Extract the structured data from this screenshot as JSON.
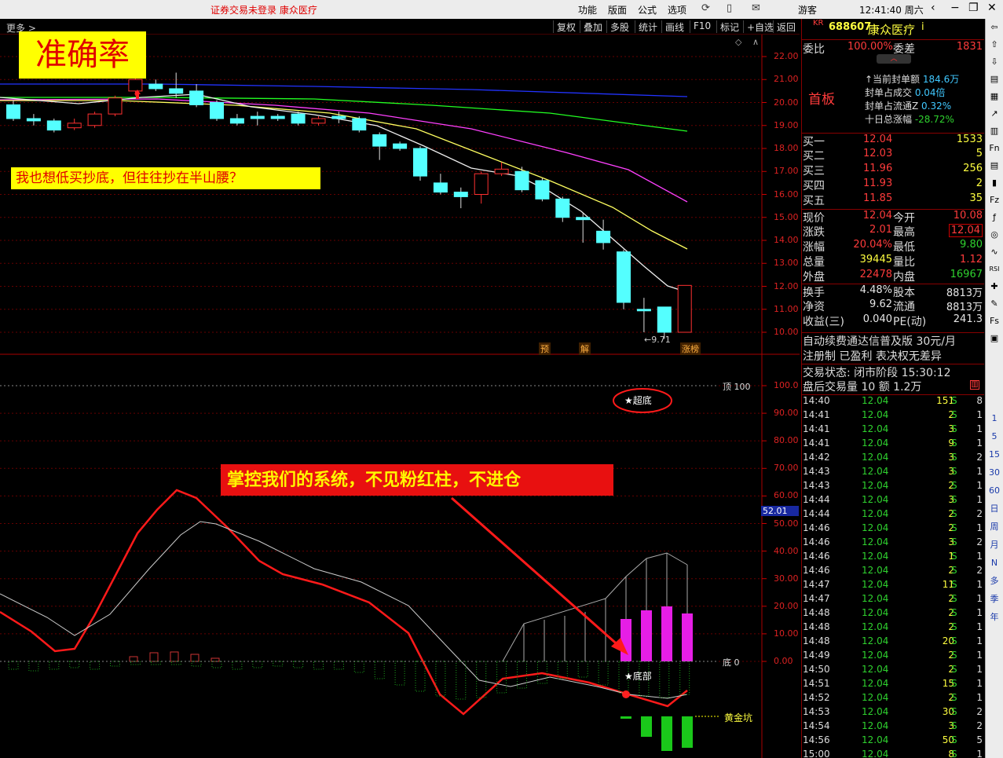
{
  "titlebar": {
    "status": "证券交易未登录  康众医疗",
    "menus": [
      "功能",
      "版面",
      "公式",
      "选项"
    ],
    "user": "游客",
    "clock": "12:41:40 周六"
  },
  "toolbar": {
    "more": "更多 >",
    "buttons": [
      "复权",
      "叠加",
      "多股",
      "统计",
      "画线",
      "F10",
      "标记",
      "+自选",
      "返回"
    ]
  },
  "annotations": {
    "accuracy": "准确率",
    "question": "我也想低买抄底，但往往抄在半山腰？",
    "system": "掌控我们的系统，不见粉红柱，不进仓",
    "chaodi": "★超底",
    "dibu": "★底部",
    "low_price": "←9.71",
    "tag_yu": "预",
    "tag_jie": "解",
    "tag_zhangbang": "涨榜",
    "top_label": "顶 100",
    "bottom_label": "底 0",
    "golden_pit": "黄金坑",
    "cursor_value": "52.01"
  },
  "price_axis": [
    "22.00",
    "21.00",
    "20.00",
    "19.00",
    "18.00",
    "17.00",
    "16.00",
    "15.00",
    "14.00",
    "13.00",
    "12.00",
    "11.00",
    "10.00"
  ],
  "ind_axis": [
    "100.0",
    "90.00",
    "80.00",
    "70.00",
    "60.00",
    "50.00",
    "40.00",
    "30.00",
    "20.00",
    "10.00",
    "0.00"
  ],
  "chart_data": {
    "type": "candlestick",
    "ylim": [
      10,
      22
    ],
    "candles": [
      {
        "o": 19.9,
        "c": 19.3,
        "h": 20.1,
        "l": 19.2
      },
      {
        "o": 19.3,
        "c": 19.2,
        "h": 19.5,
        "l": 19.0
      },
      {
        "o": 19.2,
        "c": 18.8,
        "h": 19.3,
        "l": 18.7
      },
      {
        "o": 18.9,
        "c": 19.1,
        "h": 19.3,
        "l": 18.8
      },
      {
        "o": 19.0,
        "c": 19.5,
        "h": 19.6,
        "l": 18.9
      },
      {
        "o": 19.5,
        "c": 20.2,
        "h": 20.3,
        "l": 19.4
      },
      {
        "o": 20.5,
        "c": 21.0,
        "h": 21.1,
        "l": 20.3
      },
      {
        "o": 20.8,
        "c": 20.6,
        "h": 21.0,
        "l": 20.5
      },
      {
        "o": 20.6,
        "c": 20.4,
        "h": 21.3,
        "l": 20.2
      },
      {
        "o": 20.5,
        "c": 19.9,
        "h": 20.8,
        "l": 19.8
      },
      {
        "o": 20.0,
        "c": 19.3,
        "h": 20.1,
        "l": 19.2
      },
      {
        "o": 19.3,
        "c": 19.1,
        "h": 19.5,
        "l": 19.0
      },
      {
        "o": 19.4,
        "c": 19.3,
        "h": 19.6,
        "l": 19.0
      },
      {
        "o": 19.4,
        "c": 19.3,
        "h": 19.5,
        "l": 19.2
      },
      {
        "o": 19.5,
        "c": 19.1,
        "h": 19.6,
        "l": 19.0
      },
      {
        "o": 19.1,
        "c": 19.3,
        "h": 19.4,
        "l": 19.0
      },
      {
        "o": 19.4,
        "c": 19.3,
        "h": 19.6,
        "l": 19.1
      },
      {
        "o": 19.3,
        "c": 18.8,
        "h": 19.4,
        "l": 18.7
      },
      {
        "o": 18.6,
        "c": 18.1,
        "h": 18.7,
        "l": 17.5
      },
      {
        "o": 18.2,
        "c": 18.0,
        "h": 18.3,
        "l": 17.9
      },
      {
        "o": 18.0,
        "c": 16.8,
        "h": 18.1,
        "l": 16.6
      },
      {
        "o": 16.5,
        "c": 16.1,
        "h": 16.9,
        "l": 16.0
      },
      {
        "o": 16.1,
        "c": 15.9,
        "h": 16.3,
        "l": 15.4
      },
      {
        "o": 16.0,
        "c": 16.9,
        "h": 17.0,
        "l": 15.6
      },
      {
        "o": 16.9,
        "c": 17.1,
        "h": 17.4,
        "l": 16.8
      },
      {
        "o": 17.0,
        "c": 16.2,
        "h": 17.2,
        "l": 16.1
      },
      {
        "o": 16.6,
        "c": 15.8,
        "h": 16.7,
        "l": 15.7
      },
      {
        "o": 15.8,
        "c": 15.0,
        "h": 15.9,
        "l": 14.8
      },
      {
        "o": 15.0,
        "c": 14.9,
        "h": 15.2,
        "l": 13.9
      },
      {
        "o": 14.4,
        "c": 13.9,
        "h": 14.9,
        "l": 13.6
      },
      {
        "o": 13.5,
        "c": 11.3,
        "h": 13.6,
        "l": 11.0
      },
      {
        "o": 11.0,
        "c": 11.0,
        "h": 11.5,
        "l": 10.0
      },
      {
        "o": 11.1,
        "c": 10.0,
        "h": 11.1,
        "l": 9.71
      },
      {
        "o": 10.0,
        "c": 12.04,
        "h": 12.04,
        "l": 10.0
      }
    ]
  },
  "quote": {
    "code_prefix": "KR",
    "code": "688607",
    "name": "康众医疗",
    "weibi_label": "委比",
    "weibi": "100.00%",
    "weicha_label": "委差",
    "weicha": "1831",
    "board": "首板",
    "seal_lines": [
      {
        "label": "当前封单额",
        "value": "184.6万"
      },
      {
        "label": "封单占成交",
        "value": "0.04倍"
      },
      {
        "label": "封单占流通Z",
        "value": "0.32%"
      },
      {
        "label": "十日总涨幅",
        "value": "-28.72%"
      }
    ],
    "bids": [
      {
        "label": "买一",
        "price": "12.04",
        "vol": "1533"
      },
      {
        "label": "买二",
        "price": "12.03",
        "vol": "5"
      },
      {
        "label": "买三",
        "price": "11.96",
        "vol": "256"
      },
      {
        "label": "买四",
        "price": "11.93",
        "vol": "2"
      },
      {
        "label": "买五",
        "price": "11.85",
        "vol": "35"
      }
    ],
    "stats": [
      {
        "l1": "现价",
        "v1": "12.04",
        "l2": "今开",
        "v2": "10.08"
      },
      {
        "l1": "涨跌",
        "v1": "2.01",
        "l2": "最高",
        "v2": "12.04"
      },
      {
        "l1": "涨幅",
        "v1": "20.04%",
        "l2": "最低",
        "v2": "9.80"
      },
      {
        "l1": "总量",
        "v1": "39445",
        "l2": "量比",
        "v2": "1.12"
      },
      {
        "l1": "外盘",
        "v1": "22478",
        "l2": "内盘",
        "v2": "16967"
      },
      {
        "l1": "换手",
        "v1": "4.48%",
        "l2": "股本",
        "v2": "8813万"
      },
      {
        "l1": "净资",
        "v1": "9.62",
        "l2": "流通",
        "v2": "8813万"
      },
      {
        "l1": "收益(三)",
        "v1": "0.040",
        "l2": "PE(动)",
        "v2": "241.3"
      }
    ],
    "ad": "自动续费通达信普及版  30元/月",
    "reg": "注册制 已盈利 表决权无差异",
    "trade_state": "交易状态: 闭市阶段 15:30:12",
    "after_hours": "盘后交易量 10 额 1.2万"
  },
  "ticks": [
    {
      "t": "14:40",
      "p": "12.04",
      "q": "151",
      "s": "S",
      "n": "8"
    },
    {
      "t": "14:41",
      "p": "12.04",
      "q": "2",
      "s": "S",
      "n": "1"
    },
    {
      "t": "14:41",
      "p": "12.04",
      "q": "3",
      "s": "S",
      "n": "1"
    },
    {
      "t": "14:41",
      "p": "12.04",
      "q": "9",
      "s": "S",
      "n": "1"
    },
    {
      "t": "14:42",
      "p": "12.04",
      "q": "3",
      "s": "S",
      "n": "2"
    },
    {
      "t": "14:43",
      "p": "12.04",
      "q": "3",
      "s": "S",
      "n": "1"
    },
    {
      "t": "14:43",
      "p": "12.04",
      "q": "2",
      "s": "S",
      "n": "1"
    },
    {
      "t": "14:44",
      "p": "12.04",
      "q": "3",
      "s": "S",
      "n": "1"
    },
    {
      "t": "14:44",
      "p": "12.04",
      "q": "2",
      "s": "S",
      "n": "2"
    },
    {
      "t": "14:46",
      "p": "12.04",
      "q": "2",
      "s": "S",
      "n": "1"
    },
    {
      "t": "14:46",
      "p": "12.04",
      "q": "3",
      "s": "S",
      "n": "2"
    },
    {
      "t": "14:46",
      "p": "12.04",
      "q": "1",
      "s": "S",
      "n": "1"
    },
    {
      "t": "14:46",
      "p": "12.04",
      "q": "2",
      "s": "S",
      "n": "2"
    },
    {
      "t": "14:47",
      "p": "12.04",
      "q": "11",
      "s": "S",
      "n": "1"
    },
    {
      "t": "14:47",
      "p": "12.04",
      "q": "2",
      "s": "S",
      "n": "1"
    },
    {
      "t": "14:48",
      "p": "12.04",
      "q": "2",
      "s": "S",
      "n": "1"
    },
    {
      "t": "14:48",
      "p": "12.04",
      "q": "2",
      "s": "S",
      "n": "1"
    },
    {
      "t": "14:48",
      "p": "12.04",
      "q": "20",
      "s": "S",
      "n": "1"
    },
    {
      "t": "14:49",
      "p": "12.04",
      "q": "2",
      "s": "S",
      "n": "1"
    },
    {
      "t": "14:50",
      "p": "12.04",
      "q": "2",
      "s": "S",
      "n": "1"
    },
    {
      "t": "14:51",
      "p": "12.04",
      "q": "15",
      "s": "S",
      "n": "1"
    },
    {
      "t": "14:52",
      "p": "12.04",
      "q": "2",
      "s": "S",
      "n": "1"
    },
    {
      "t": "14:53",
      "p": "12.04",
      "q": "30",
      "s": "S",
      "n": "2"
    },
    {
      "t": "14:54",
      "p": "12.04",
      "q": "3",
      "s": "S",
      "n": "2"
    },
    {
      "t": "14:56",
      "p": "12.04",
      "q": "50",
      "s": "S",
      "n": "5"
    },
    {
      "t": "15:00",
      "p": "12.04",
      "q": "8",
      "s": "S",
      "n": "1"
    }
  ],
  "sidebar": [
    "1",
    "5",
    "15",
    "30",
    "60",
    "日",
    "周",
    "月",
    "N",
    "多",
    "季",
    "年"
  ]
}
